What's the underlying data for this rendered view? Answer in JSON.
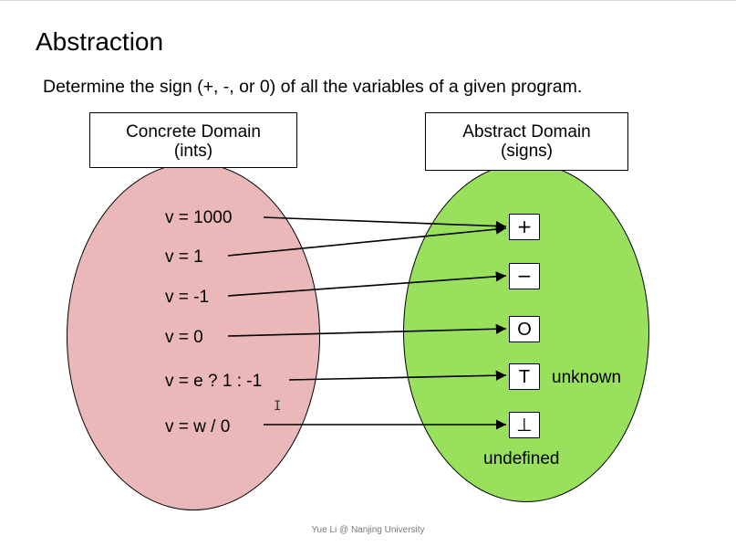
{
  "slide": {
    "title": "Abstraction",
    "subtitle": "Determine the sign (+, -, or 0) of all the variables of a given program.",
    "footer": "Yue Li @ Nanjing University"
  },
  "concrete_domain": {
    "title": "Concrete Domain",
    "subtitle": "(ints)",
    "color": "#eab8b9",
    "values": [
      "v = 1000",
      "v = 1",
      "v = -1",
      "v = 0",
      "v = e ? 1 : -1",
      "v = w / 0"
    ]
  },
  "abstract_domain": {
    "title": "Abstract Domain",
    "subtitle": "(signs)",
    "color": "#99e05c",
    "symbols": [
      "+",
      "−",
      "O",
      "T",
      "⊥"
    ],
    "labels": {
      "top": "unknown",
      "bottom": "undefined"
    }
  },
  "mappings": [
    {
      "from": "v = 1000",
      "to": "+"
    },
    {
      "from": "v = 1",
      "to": "+"
    },
    {
      "from": "v = -1",
      "to": "−"
    },
    {
      "from": "v = 0",
      "to": "O"
    },
    {
      "from": "v = e ? 1 : -1",
      "to": "T"
    },
    {
      "from": "v = w / 0",
      "to": "⊥"
    }
  ],
  "icons": {
    "cursor": "text-cursor-icon"
  }
}
